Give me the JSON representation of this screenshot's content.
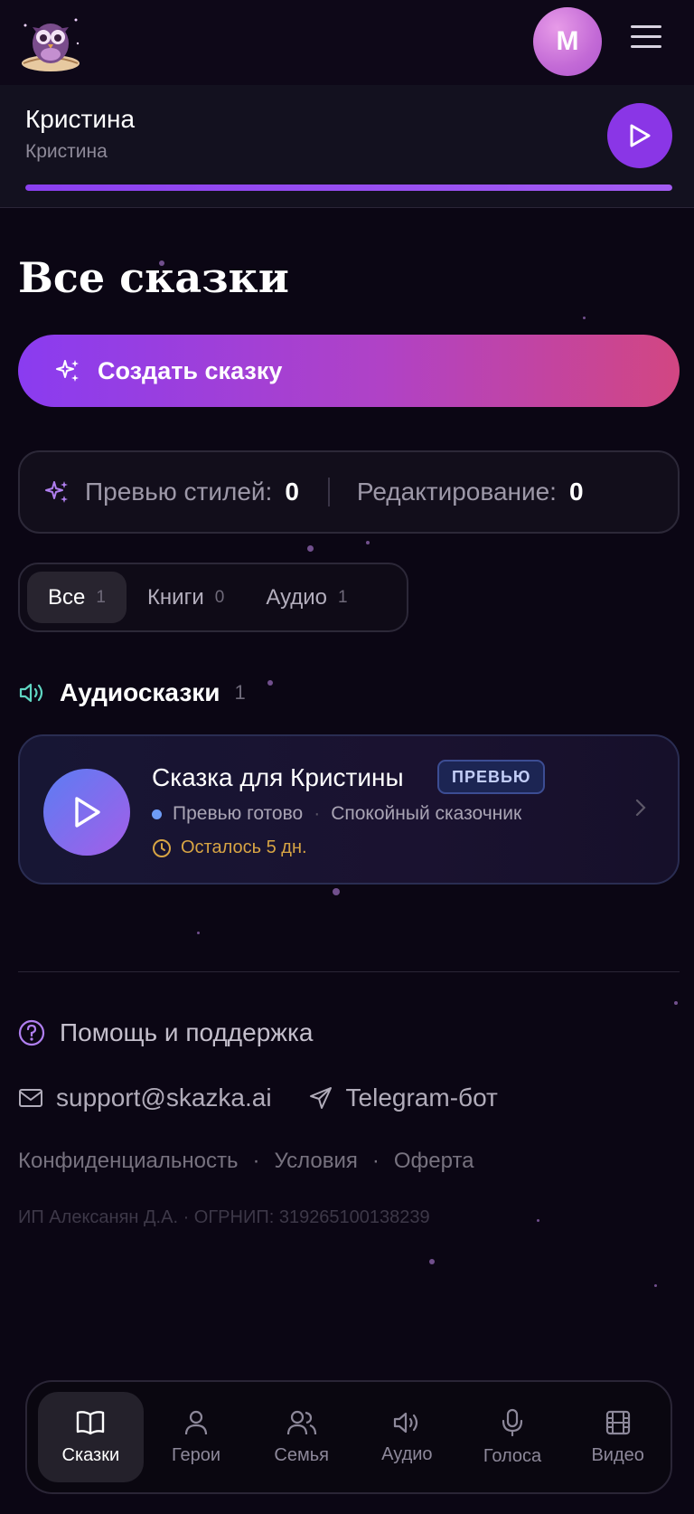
{
  "header": {
    "avatar_initial": "M",
    "logo_icon": "owl-book-logo",
    "menu_icon": "hamburger-menu-icon"
  },
  "player": {
    "title": "Кристина",
    "subtitle": "Кристина",
    "progress": 1.0,
    "play_icon": "play-icon"
  },
  "page": {
    "title": "Все сказки"
  },
  "create_button": {
    "label": "Создать сказку",
    "icon": "sparkles-icon"
  },
  "quota": {
    "styles_label": "Превью стилей:",
    "styles_count": "0",
    "edit_label": "Редактирование:",
    "edit_count": "0",
    "icon": "sparkles-icon"
  },
  "filter_tabs": [
    {
      "label": "Все",
      "count": "1",
      "active": true
    },
    {
      "label": "Книги",
      "count": "0",
      "active": false
    },
    {
      "label": "Аудио",
      "count": "1",
      "active": false
    }
  ],
  "audio_section": {
    "title": "Аудиосказки",
    "count": "1",
    "icon": "speaker-icon"
  },
  "story_card": {
    "title": "Сказка для Кристины",
    "badge": "ПРЕВЬЮ",
    "status": "Превью готово",
    "separator": "·",
    "narrator": "Спокойный сказочник",
    "expires": "Осталось 5 дн."
  },
  "support": {
    "title": "Помощь и поддержка",
    "email": "support@skazka.ai",
    "telegram": "Telegram-бот",
    "links": [
      "Конфиденциальность",
      "Условия",
      "Оферта"
    ],
    "separator": "·",
    "company": "ИП Алексанян Д.А. · ОГРНИП: 319265100138239"
  },
  "bottom_nav": [
    {
      "label": "Сказки",
      "icon": "book-icon",
      "active": true
    },
    {
      "label": "Герои",
      "icon": "person-icon",
      "active": false
    },
    {
      "label": "Семья",
      "icon": "people-icon",
      "active": false
    },
    {
      "label": "Аудио",
      "icon": "speaker-icon",
      "active": false
    },
    {
      "label": "Голоса",
      "icon": "microphone-icon",
      "active": false
    },
    {
      "label": "Видео",
      "icon": "film-icon",
      "active": false
    }
  ],
  "colors": {
    "background": "#0b0614",
    "accent": "#8a36e6",
    "create_gradient_end": "#d24682",
    "badge_bg": "#1c2553",
    "expires": "#d8a544"
  }
}
